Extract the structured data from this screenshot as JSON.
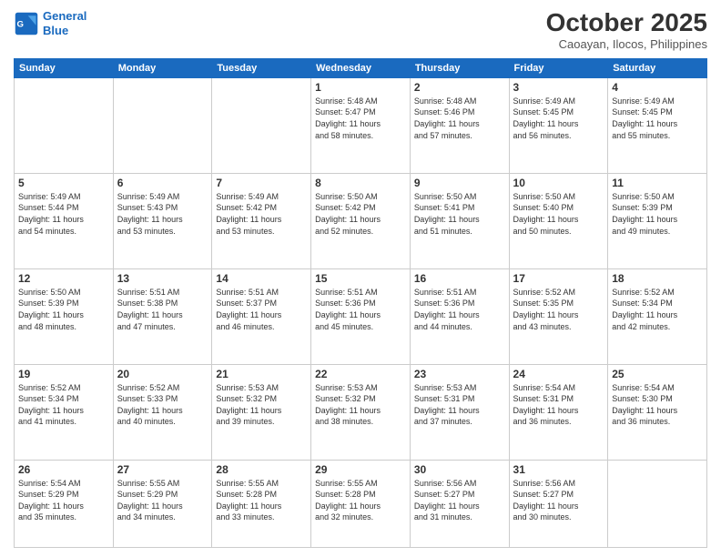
{
  "header": {
    "logo_line1": "General",
    "logo_line2": "Blue",
    "month": "October 2025",
    "location": "Caoayan, Ilocos, Philippines"
  },
  "weekdays": [
    "Sunday",
    "Monday",
    "Tuesday",
    "Wednesday",
    "Thursday",
    "Friday",
    "Saturday"
  ],
  "weeks": [
    [
      {
        "day": "",
        "info": ""
      },
      {
        "day": "",
        "info": ""
      },
      {
        "day": "",
        "info": ""
      },
      {
        "day": "1",
        "info": "Sunrise: 5:48 AM\nSunset: 5:47 PM\nDaylight: 11 hours\nand 58 minutes."
      },
      {
        "day": "2",
        "info": "Sunrise: 5:48 AM\nSunset: 5:46 PM\nDaylight: 11 hours\nand 57 minutes."
      },
      {
        "day": "3",
        "info": "Sunrise: 5:49 AM\nSunset: 5:45 PM\nDaylight: 11 hours\nand 56 minutes."
      },
      {
        "day": "4",
        "info": "Sunrise: 5:49 AM\nSunset: 5:45 PM\nDaylight: 11 hours\nand 55 minutes."
      }
    ],
    [
      {
        "day": "5",
        "info": "Sunrise: 5:49 AM\nSunset: 5:44 PM\nDaylight: 11 hours\nand 54 minutes."
      },
      {
        "day": "6",
        "info": "Sunrise: 5:49 AM\nSunset: 5:43 PM\nDaylight: 11 hours\nand 53 minutes."
      },
      {
        "day": "7",
        "info": "Sunrise: 5:49 AM\nSunset: 5:42 PM\nDaylight: 11 hours\nand 53 minutes."
      },
      {
        "day": "8",
        "info": "Sunrise: 5:50 AM\nSunset: 5:42 PM\nDaylight: 11 hours\nand 52 minutes."
      },
      {
        "day": "9",
        "info": "Sunrise: 5:50 AM\nSunset: 5:41 PM\nDaylight: 11 hours\nand 51 minutes."
      },
      {
        "day": "10",
        "info": "Sunrise: 5:50 AM\nSunset: 5:40 PM\nDaylight: 11 hours\nand 50 minutes."
      },
      {
        "day": "11",
        "info": "Sunrise: 5:50 AM\nSunset: 5:39 PM\nDaylight: 11 hours\nand 49 minutes."
      }
    ],
    [
      {
        "day": "12",
        "info": "Sunrise: 5:50 AM\nSunset: 5:39 PM\nDaylight: 11 hours\nand 48 minutes."
      },
      {
        "day": "13",
        "info": "Sunrise: 5:51 AM\nSunset: 5:38 PM\nDaylight: 11 hours\nand 47 minutes."
      },
      {
        "day": "14",
        "info": "Sunrise: 5:51 AM\nSunset: 5:37 PM\nDaylight: 11 hours\nand 46 minutes."
      },
      {
        "day": "15",
        "info": "Sunrise: 5:51 AM\nSunset: 5:36 PM\nDaylight: 11 hours\nand 45 minutes."
      },
      {
        "day": "16",
        "info": "Sunrise: 5:51 AM\nSunset: 5:36 PM\nDaylight: 11 hours\nand 44 minutes."
      },
      {
        "day": "17",
        "info": "Sunrise: 5:52 AM\nSunset: 5:35 PM\nDaylight: 11 hours\nand 43 minutes."
      },
      {
        "day": "18",
        "info": "Sunrise: 5:52 AM\nSunset: 5:34 PM\nDaylight: 11 hours\nand 42 minutes."
      }
    ],
    [
      {
        "day": "19",
        "info": "Sunrise: 5:52 AM\nSunset: 5:34 PM\nDaylight: 11 hours\nand 41 minutes."
      },
      {
        "day": "20",
        "info": "Sunrise: 5:52 AM\nSunset: 5:33 PM\nDaylight: 11 hours\nand 40 minutes."
      },
      {
        "day": "21",
        "info": "Sunrise: 5:53 AM\nSunset: 5:32 PM\nDaylight: 11 hours\nand 39 minutes."
      },
      {
        "day": "22",
        "info": "Sunrise: 5:53 AM\nSunset: 5:32 PM\nDaylight: 11 hours\nand 38 minutes."
      },
      {
        "day": "23",
        "info": "Sunrise: 5:53 AM\nSunset: 5:31 PM\nDaylight: 11 hours\nand 37 minutes."
      },
      {
        "day": "24",
        "info": "Sunrise: 5:54 AM\nSunset: 5:31 PM\nDaylight: 11 hours\nand 36 minutes."
      },
      {
        "day": "25",
        "info": "Sunrise: 5:54 AM\nSunset: 5:30 PM\nDaylight: 11 hours\nand 36 minutes."
      }
    ],
    [
      {
        "day": "26",
        "info": "Sunrise: 5:54 AM\nSunset: 5:29 PM\nDaylight: 11 hours\nand 35 minutes."
      },
      {
        "day": "27",
        "info": "Sunrise: 5:55 AM\nSunset: 5:29 PM\nDaylight: 11 hours\nand 34 minutes."
      },
      {
        "day": "28",
        "info": "Sunrise: 5:55 AM\nSunset: 5:28 PM\nDaylight: 11 hours\nand 33 minutes."
      },
      {
        "day": "29",
        "info": "Sunrise: 5:55 AM\nSunset: 5:28 PM\nDaylight: 11 hours\nand 32 minutes."
      },
      {
        "day": "30",
        "info": "Sunrise: 5:56 AM\nSunset: 5:27 PM\nDaylight: 11 hours\nand 31 minutes."
      },
      {
        "day": "31",
        "info": "Sunrise: 5:56 AM\nSunset: 5:27 PM\nDaylight: 11 hours\nand 30 minutes."
      },
      {
        "day": "",
        "info": ""
      }
    ]
  ]
}
